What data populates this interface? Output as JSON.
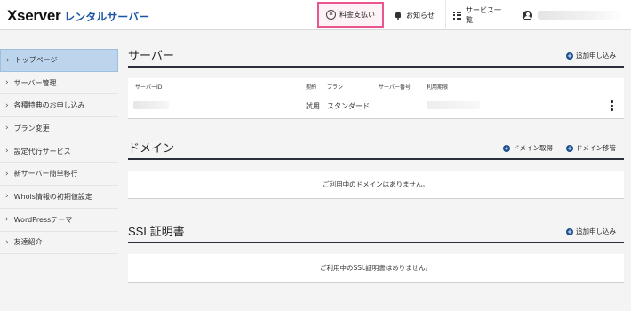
{
  "brand": {
    "name": "Xserver",
    "product": "レンタルサーバー"
  },
  "topnav": {
    "payment": {
      "icon": "yen-icon",
      "label": "料金支払い",
      "highlight_color": "#e8558f"
    },
    "notifications": {
      "icon": "bell-icon",
      "label": "お知らせ"
    },
    "services": {
      "icon": "grid-icon",
      "label": "サービス一覧"
    },
    "account": {
      "icon": "user-icon"
    }
  },
  "sidebar": {
    "items": [
      {
        "label": "トップページ",
        "active": true
      },
      {
        "label": "サーバー管理"
      },
      {
        "label": "各種特典のお申し込み"
      },
      {
        "label": "プラン変更"
      },
      {
        "label": "設定代行サービス"
      },
      {
        "label": "新サーバー簡単移行"
      },
      {
        "label": "Whois情報の初期値設定"
      },
      {
        "label": "WordPressテーマ"
      },
      {
        "label": "友達紹介"
      }
    ],
    "chevron": "›"
  },
  "server": {
    "title": "サーバー",
    "add_label": "追加申し込み",
    "columns": {
      "id": "サーバーID",
      "contract": "契約",
      "plan": "プラン",
      "number": "サーバー番号",
      "expiry": "利用期限"
    },
    "rows": [
      {
        "contract": "試用",
        "plan": "スタンダード"
      }
    ]
  },
  "domain": {
    "title": "ドメイン",
    "acquire_label": "ドメイン取得",
    "transfer_label": "ドメイン移管",
    "empty": "ご利用中のドメインはありません。"
  },
  "ssl": {
    "title": "SSL証明書",
    "add_label": "追加申し込み",
    "empty": "ご利用中のSSL証明書はありません。"
  },
  "colors": {
    "accent": "#1b4f8f",
    "active_sidebar": "#bcd4ec",
    "brand_blue": "#1a56a8"
  }
}
